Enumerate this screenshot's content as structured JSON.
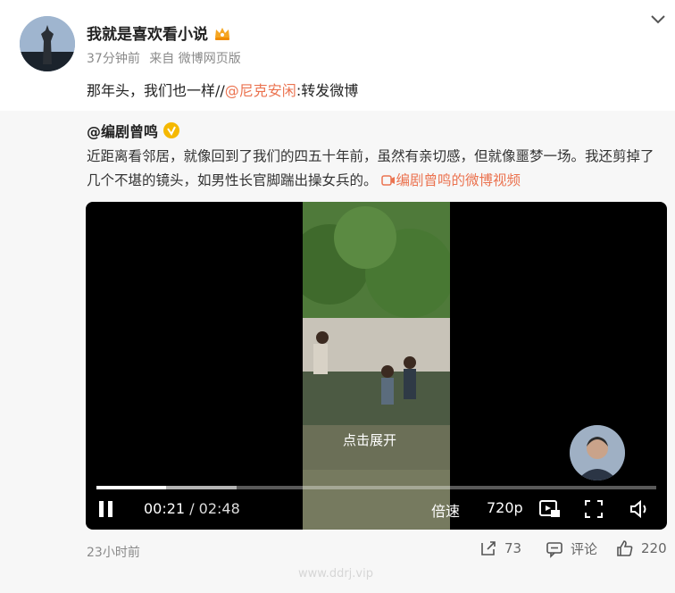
{
  "post": {
    "username": "我就是喜欢看小说",
    "time": "37分钟前",
    "source": "来自 微博网页版",
    "text_prefix": "那年头，我们也一样//",
    "mention": "@尼克安闲",
    "text_suffix": ":转发微博"
  },
  "repost": {
    "author": "@编剧曾鸣",
    "text": "近距离看邻居，就像回到了我们的四五十年前，虽然有亲切感，但就像噩梦一场。我还剪掉了几个不堪的镜头，如男性长官脚踹出操女兵的。",
    "video_link": "编剧曾鸣的微博视频",
    "video": {
      "expand_tip": "点击展开",
      "current_time": "00:21",
      "separator": " / ",
      "duration": "02:48",
      "progress": 0.125,
      "buffered": 0.25,
      "speed_label": "倍速",
      "quality_label": "720p"
    },
    "footer": {
      "time": "23小时前",
      "repost_count": "73",
      "comment_label": "评论",
      "like_count": "220"
    }
  },
  "watermark": "www.ddrj.vip",
  "colors": {
    "accent": "#eb7350",
    "verified": "#f5b800"
  }
}
